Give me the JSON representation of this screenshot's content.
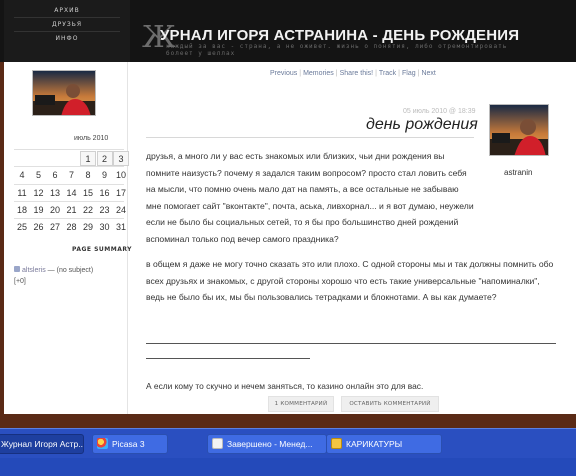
{
  "nav": {
    "items": [
      "АРХИВ",
      "ДРУЗЬЯ",
      "ИНФО"
    ]
  },
  "header": {
    "big_letter": "Ж",
    "title": "УРНАЛ ИГОРЯ АСТРАНИНА - ДЕНЬ РОЖДЕНИЯ",
    "tagline": "каждый за вас - страна, а не оживет. жизнь о понятия, либо отремонтировать болеет у шеллах"
  },
  "post_nav": [
    "Previous",
    "Memories",
    "Share this!",
    "Track",
    "Flag",
    "Next"
  ],
  "calendar": {
    "month": "июль 2010",
    "rows": [
      [
        "",
        "",
        "",
        "",
        "1",
        "2",
        "3"
      ],
      [
        "4",
        "5",
        "6",
        "7",
        "8",
        "9",
        "10"
      ],
      [
        "11",
        "12",
        "13",
        "14",
        "15",
        "16",
        "17"
      ],
      [
        "18",
        "19",
        "20",
        "21",
        "22",
        "23",
        "24"
      ],
      [
        "25",
        "26",
        "27",
        "28",
        "29",
        "30",
        "31"
      ]
    ]
  },
  "sidebar": {
    "page_summary": "PAGE SUMMARY",
    "entry_user": "altsleris",
    "entry_text": " — (no subject)",
    "entry_count": "[+0]"
  },
  "post": {
    "date": "05 июль 2010 @ 18:39",
    "title": "день рождения",
    "username": "astranin",
    "para1": "друзья, а много ли у вас есть знакомых или близких, чьи дни рождения вы помните наизусть? почему я задался таким вопросом? просто стал ловить себя на мысли, что помню очень мало дат на память, а все остальные не забываю мне помогает сайт \"вконтакте\", почта, аська, ливхорнал... и я вот думаю, неужели если не было бы социальных сетей, то я бы про большинство дней рождений вспоминал только под вечер самого праздника?",
    "para2": "в общем я даже не могу точно сказать это или плохо. С одной стороны мы и так должны помнить обо всех друзьях и знакомых, с другой стороны хорошо что есть такие универсальные \"напоминалки\", ведь не было бы их, мы бы пользовались тетрадками и блокнотами. А вы как думаете?",
    "ad_prefix": "А если кому то скучно и нечем заняться, то ",
    "ad_link": "казино онлайн",
    "ad_suffix": " это для вас.",
    "btn_comments": "1 КОММЕНТАРИЙ",
    "btn_leave": "ОСТАВИТЬ КОММЕНТАРИЙ"
  },
  "taskbar": {
    "items": [
      "Журнал Игоря Астр...",
      "Picasa 3",
      "Завершено - Менед...",
      "КАРИКАТУРЫ"
    ]
  },
  "colors": {
    "header_bg": "#141414",
    "taskbar_bg": "#2a4fc0",
    "frame_bg": "#5a2a16"
  }
}
